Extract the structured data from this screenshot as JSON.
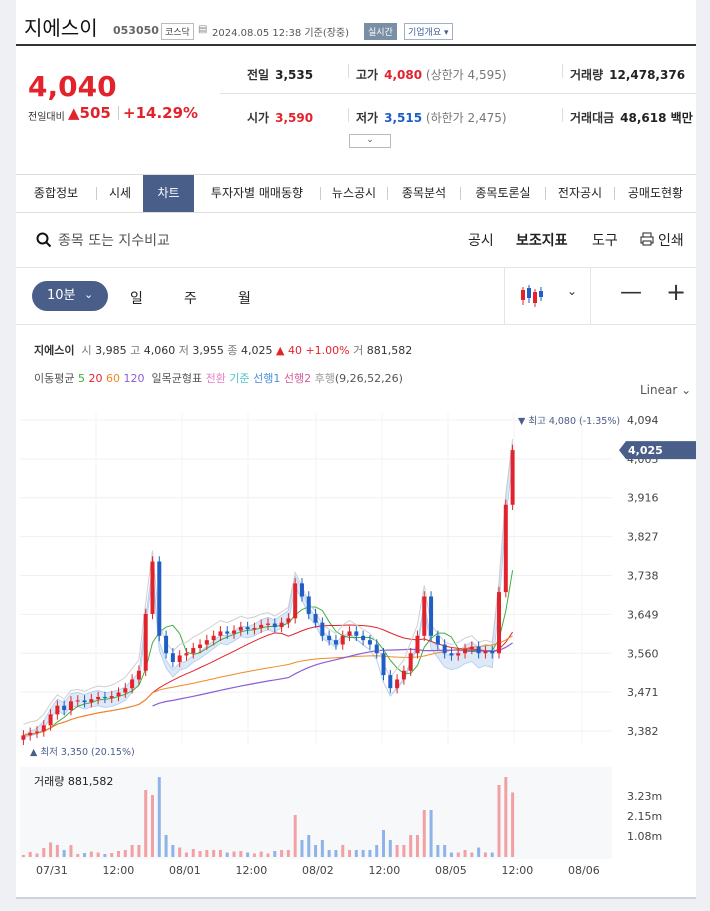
{
  "header": {
    "name": "지에스이",
    "code": "053050",
    "market": "코스닥",
    "datetime": "2024.08.05 12:38 기준(장중)",
    "realtime": "실시간",
    "company_btn": "기업개요"
  },
  "price": {
    "current": "4,040",
    "change_label": "전일대비",
    "change_arrow": "▲",
    "change": "505",
    "change_pct": "+14.29%"
  },
  "stats": {
    "prev_label": "전일",
    "prev": "3,535",
    "high_label": "고가",
    "high": "4,080",
    "upper_limit": "(상한가 4,595)",
    "volume_label": "거래량",
    "volume": "12,478,376",
    "open_label": "시가",
    "open": "3,590",
    "low_label": "저가",
    "low": "3,515",
    "lower_limit": "(하한가 2,475)",
    "amount_label": "거래대금",
    "amount": "48,618 백만"
  },
  "toggle_icon": "chevron-down-icon",
  "tabs": [
    "종합정보",
    "시세",
    "차트",
    "투자자별 매매동향",
    "뉴스공시",
    "종목분석",
    "종목토론실",
    "전자공시",
    "공매도현황"
  ],
  "active_tab": "차트",
  "search": {
    "placeholder": "종목 또는 지수비교",
    "icon": "search-icon"
  },
  "tools": [
    "공시",
    "보조지표",
    "도구",
    "인쇄"
  ],
  "period": {
    "selected": "10분",
    "items": [
      "일",
      "주",
      "월"
    ]
  },
  "chart_legend": {
    "name": "지에스이",
    "open_label": "시",
    "open": "3,985",
    "high_label": "고",
    "high": "4,060",
    "low_label": "저",
    "low": "3,955",
    "close_label": "종",
    "close": "4,025",
    "chg": "▲ 40",
    "chg_pct": "+1.00%",
    "vol_label": "거",
    "vol": "881,582"
  },
  "indicators": {
    "ma_label": "이동평균",
    "ma": [
      "5",
      "20",
      "60",
      "120"
    ],
    "ichimoku_label": "일목균형표",
    "ich": [
      "전환",
      "기준",
      "선행1",
      "선행2",
      "후행"
    ],
    "ich_params": "(9,26,52,26)"
  },
  "scale": "Linear",
  "max_label": "▼ 최고 4,080 (-1.35%)",
  "min_label": "▲ 최저 3,350 (20.15%)",
  "current_tag": "4,025",
  "volume_panel": {
    "label": "거래량",
    "value": "881,582"
  },
  "colors": {
    "up": "#e3232c",
    "down": "#1f5fc5",
    "accent": "#4a5e8a"
  },
  "chart_data": {
    "type": "candlestick",
    "y_ticks": [
      "4,094",
      "4,005",
      "3,916",
      "3,827",
      "3,738",
      "3,649",
      "3,560",
      "3,471",
      "3,382"
    ],
    "x_ticks": [
      "07/31",
      "12:00",
      "08/01",
      "12:00",
      "08/02",
      "12:00",
      "08/05",
      "12:00",
      "08/06"
    ],
    "vol_ticks": [
      "3.23m",
      "2.15m",
      "1.08m"
    ],
    "ylim": [
      3350,
      4110
    ],
    "close": [
      3372,
      3378,
      3381,
      3395,
      3420,
      3440,
      3430,
      3450,
      3452,
      3448,
      3455,
      3460,
      3458,
      3462,
      3470,
      3480,
      3500,
      3520,
      3650,
      3770,
      3600,
      3560,
      3540,
      3555,
      3560,
      3572,
      3580,
      3590,
      3600,
      3610,
      3605,
      3612,
      3620,
      3615,
      3618,
      3625,
      3628,
      3620,
      3630,
      3640,
      3720,
      3690,
      3650,
      3630,
      3600,
      3590,
      3580,
      3600,
      3610,
      3600,
      3590,
      3580,
      3560,
      3510,
      3480,
      3500,
      3520,
      3560,
      3600,
      3690,
      3600,
      3580,
      3560,
      3555,
      3560,
      3570,
      3575,
      3560,
      3565,
      3560,
      3700,
      3900,
      4025
    ]
  }
}
